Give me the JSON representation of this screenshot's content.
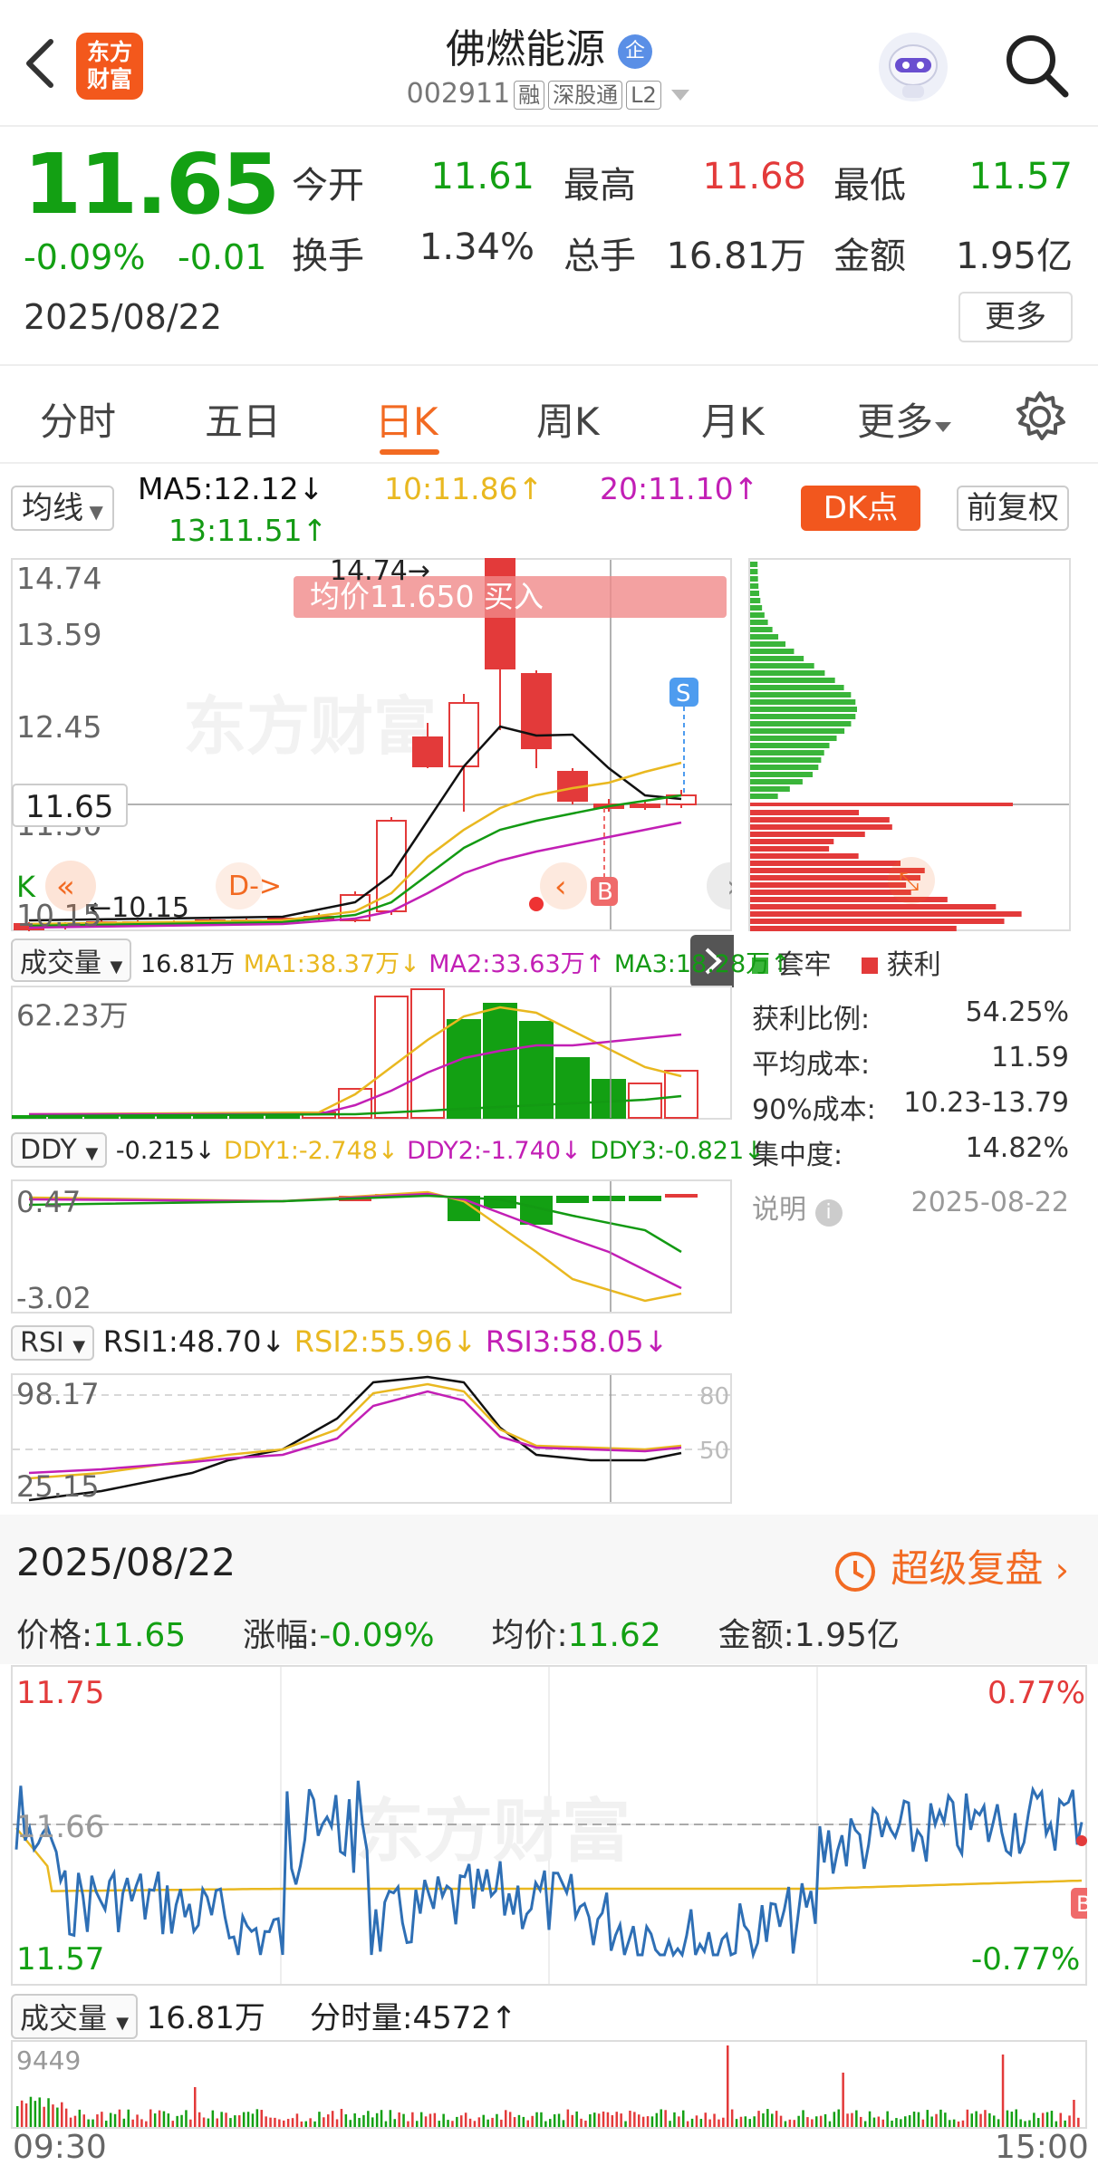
{
  "header": {
    "logo_text": "东方财富",
    "stock_name": "佛燃能源",
    "badge": "企",
    "code": "002911",
    "tags": [
      "融",
      "深股通",
      "L2"
    ]
  },
  "quote": {
    "price": "11.65",
    "change_pct": "-0.09%",
    "change": "-0.01",
    "date": "2025/08/22",
    "open_label": "今开",
    "open": "11.61",
    "high_label": "最高",
    "high": "11.68",
    "low_label": "最低",
    "low": "11.57",
    "turnover_label": "换手",
    "turnover": "1.34%",
    "volume_label": "总手",
    "volume": "16.81万",
    "amount_label": "金额",
    "amount": "1.95亿",
    "more_button": "更多"
  },
  "tabs": [
    {
      "label": "分时"
    },
    {
      "label": "五日"
    },
    {
      "label": "日K"
    },
    {
      "label": "周K"
    },
    {
      "label": "月K"
    },
    {
      "label": "更多"
    }
  ],
  "ma": {
    "selector": "均线",
    "ma5": "MA5:12.12↓",
    "ma10": "10:11.86↑",
    "ma20": "20:11.10↑",
    "ma13": "13:11.51↑",
    "dk_button": "DK点",
    "fq_button": "前复权"
  },
  "kline": {
    "y_labels": [
      "14.74",
      "13.59",
      "12.45",
      "11.65",
      "11.30",
      "10.15"
    ],
    "tooltip": "均价11.650  买入",
    "high_marker": "14.74→",
    "low_marker": "←10.15",
    "s_marker": "S",
    "b_marker": "B",
    "k_label": "K"
  },
  "chips": {
    "legend_trapped": "套牢",
    "legend_profit": "获利",
    "rows": [
      {
        "label": "获利比例:",
        "value": "54.25%"
      },
      {
        "label": "平均成本:",
        "value": "11.59"
      },
      {
        "label": "90%成本:",
        "value": "10.23-13.79"
      },
      {
        "label": "集中度:",
        "value": "14.82%"
      }
    ],
    "note_label": "说明",
    "note_date": "2025-08-22"
  },
  "volume": {
    "selector": "成交量",
    "value": "16.81万",
    "ma1": "MA1:38.37万↓",
    "ma2": "MA2:33.63万↑",
    "ma3": "MA3:18.28万↑",
    "y_label": "62.23万"
  },
  "ddy": {
    "selector": "DDY",
    "value": "-0.215↓",
    "ddy1": "DDY1:-2.748↓",
    "ddy2": "DDY2:-1.740↓",
    "ddy3": "DDY3:-0.821↓",
    "y_top": "0.47",
    "y_bottom": "-3.02"
  },
  "rsi": {
    "selector": "RSI",
    "rsi1": "RSI1:48.70↓",
    "rsi2": "RSI2:55.96↓",
    "rsi3": "RSI3:58.05↓",
    "y_top": "98.17",
    "y_bottom": "25.15",
    "level_80": "80",
    "level_50": "50"
  },
  "intraday": {
    "date": "2025/08/22",
    "replay": "超级复盘",
    "price_label": "价格:",
    "price": "11.65",
    "chg_label": "涨幅:",
    "chg": "-0.09%",
    "avg_label": "均价:",
    "avg": "11.62",
    "amount_label": "金额:",
    "amount": "1.95亿",
    "y_top": "11.75",
    "y_mid": "11.66",
    "y_bottom": "11.57",
    "pct_top": "0.77%",
    "pct_bottom": "-0.77%",
    "b_marker": "B",
    "vol_selector": "成交量",
    "vol_value": "16.81万",
    "vol_tick": "分时量:4572↑",
    "vol_y": "9449",
    "time_start": "09:30",
    "time_end": "15:00"
  },
  "colors": {
    "up": "#e33a3a",
    "down": "#13a013",
    "accent": "#f26a22",
    "ma5": "#111111",
    "ma10": "#e9b820",
    "ma20": "#c21fb5",
    "ma13": "#139a13"
  }
}
